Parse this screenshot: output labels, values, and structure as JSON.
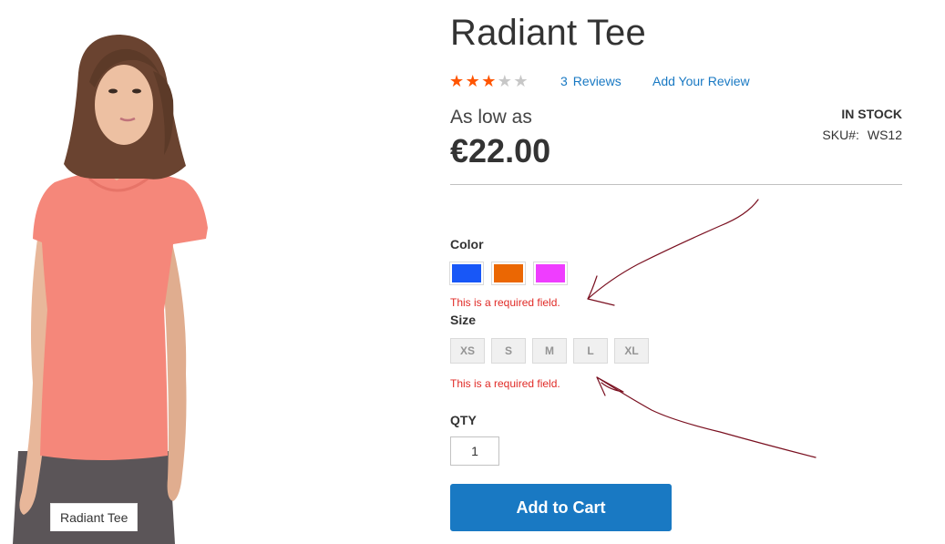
{
  "product": {
    "name": "Radiant Tee",
    "image_caption": "Radiant Tee",
    "rating": 3,
    "rating_max": 5,
    "reviews_count": "3",
    "reviews_label": "Reviews",
    "add_review_label": "Add Your Review",
    "price_label": "As low as",
    "price": "€22.00",
    "stock_status": "In stock",
    "sku_label": "SKU#:",
    "sku": "WS12"
  },
  "options": {
    "color_label": "Color",
    "colors": [
      {
        "name": "Blue",
        "hex": "#1857f7"
      },
      {
        "name": "Orange",
        "hex": "#eb6703"
      },
      {
        "name": "Purple",
        "hex": "#ef3dff"
      }
    ],
    "color_error": "This is a required field.",
    "size_label": "Size",
    "sizes": [
      "XS",
      "S",
      "M",
      "L",
      "XL"
    ],
    "size_error": "This is a required field."
  },
  "cart": {
    "qty_label": "QTY",
    "qty_value": "1",
    "add_to_cart_label": "Add to Cart"
  },
  "colors": {
    "accent": "#1979c3",
    "star_filled": "#ff5501",
    "error": "#e02b27",
    "annotation": "#7a1020"
  }
}
